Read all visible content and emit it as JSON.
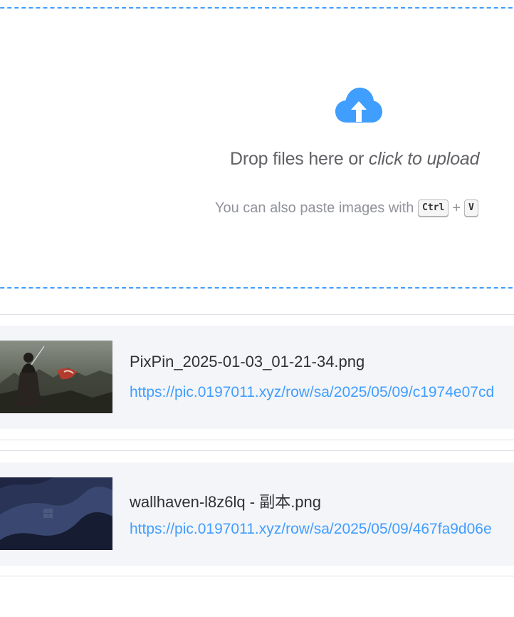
{
  "upload": {
    "drop_text": "Drop files here or ",
    "click_text": "click to upload",
    "paste_hint": "You can also paste images with",
    "key_ctrl": "Ctrl",
    "plus": "+",
    "key_v": "V",
    "icon": "cloud-upload-icon",
    "accent_color": "#409eff"
  },
  "files": [
    {
      "name": "PixPin_2025-01-03_01-21-34.png",
      "url": "https://pic.0197011.xyz/row/sa/2025/05/09/c1974e07cd",
      "thumbnail": "dark-samurai-artwork"
    },
    {
      "name": "wallhaven-l8z6lq - 副本.png",
      "url": "https://pic.0197011.xyz/row/sa/2025/05/09/467fa9d06e",
      "thumbnail": "navy-wave-wallpaper"
    }
  ]
}
